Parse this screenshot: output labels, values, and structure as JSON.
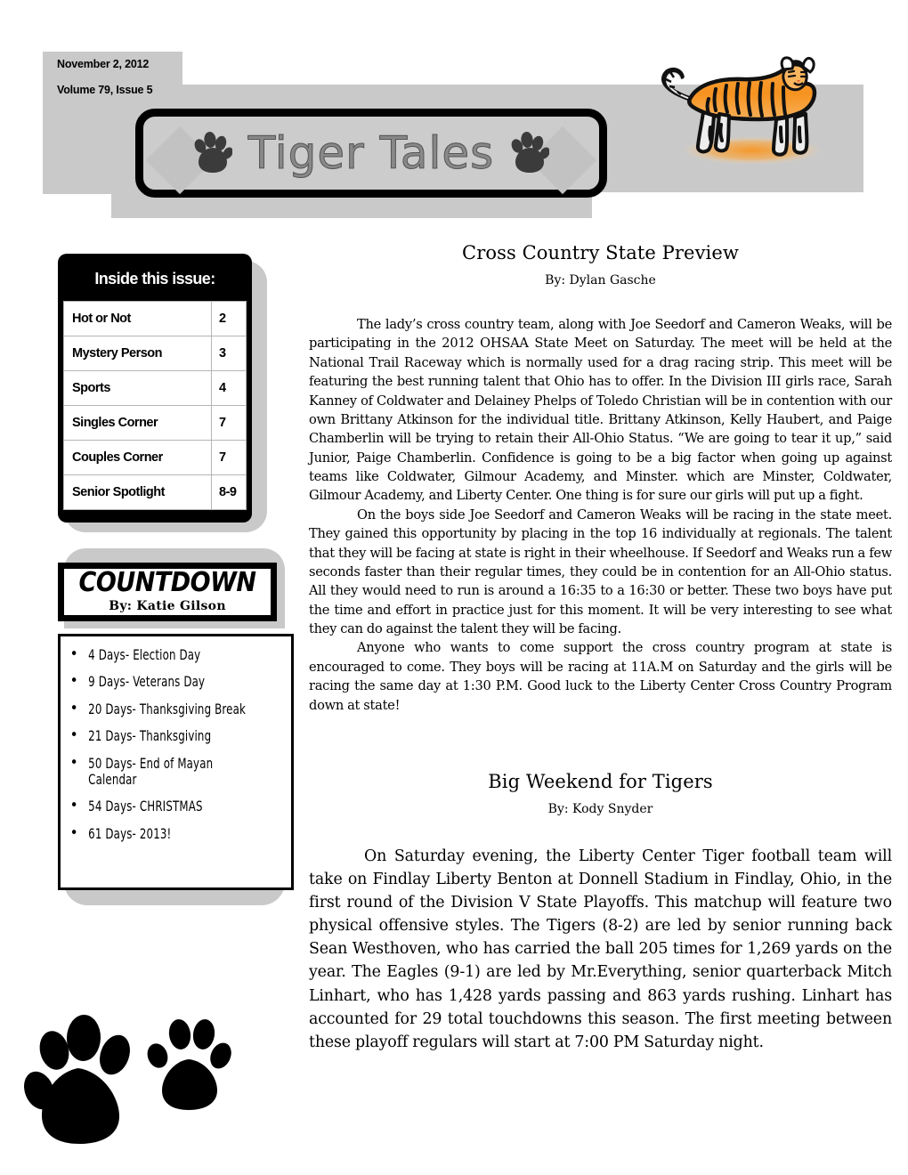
{
  "header": {
    "date": "November 2, 2012",
    "volume": "Volume 79, Issue 5",
    "masthead_title": "Tiger Tales",
    "paw_icon_name": "paw-print-icon",
    "tiger_icon_name": "tiger-mascot-icon",
    "colors": {
      "band_gray": "#c9c9c9",
      "plaque_gray": "#cccccc",
      "tiger_orange": "#f59a2e",
      "black": "#000000"
    }
  },
  "inside_issue": {
    "title": "Inside this issue:",
    "rows": [
      {
        "section": "Hot or Not",
        "page": "2"
      },
      {
        "section": "Mystery Person",
        "page": "3"
      },
      {
        "section": "Sports",
        "page": "4"
      },
      {
        "section": "Singles Corner",
        "page": "7"
      },
      {
        "section": "Couples Corner",
        "page": "7"
      },
      {
        "section": "Senior Spotlight",
        "page": "8-9"
      }
    ]
  },
  "countdown": {
    "title": "COUNTDOWN",
    "byline": "By: Katie Gilson",
    "items": [
      "4 Days- Election Day",
      "9 Days- Veterans Day",
      "20 Days- Thanksgiving Break",
      "21 Days- Thanksgiving",
      "50 Days- End of Mayan Calendar",
      "54 Days- CHRISTMAS",
      "61 Days- 2013!"
    ]
  },
  "articles": [
    {
      "headline": "Cross Country State Preview",
      "byline": "By: Dylan Gasche",
      "paragraphs": [
        "The lady’s cross country team, along with Joe Seedorf and Cameron Weaks, will be participating in the 2012 OHSAA State Meet on Saturday. The meet will be held at the National Trail Raceway which is normally used for a drag racing strip. This meet will be featuring the best running talent that  Ohio has to offer. In the Division III girls race, Sarah Kanney of Coldwater and Delainey Phelps of Toledo Christian will be in contention with our own Brittany Atkinson for the individual title.  Brittany Atkinson, Kelly Haubert, and Paige Chamberlin will be trying to retain their All-Ohio Status. “We are going to tear it up,” said Junior, Paige Chamberlin. Confidence is going to be a big factor when going up against teams like Coldwater, Gilmour Academy, and  Minster. which are Minster, Coldwater, Gilmour Academy, and Liberty Center. One thing is for sure our girls will put up a fight.",
        "On the boys side Joe Seedorf and Cameron Weaks will be racing in the state meet. They gained this opportunity by placing in the top 16 individually at regionals. The talent that they will be facing at state is right in their wheelhouse. If Seedorf and Weaks run a few seconds faster than their regular times, they could be in contention for an All-Ohio status. All they would need to run is around a 16:35 to a 16:30 or better. These two boys have put the time and effort in practice just for this moment. It will be very interesting to see what they can do against the talent they will be facing.",
        "Anyone who wants to come support the cross country program at state is encouraged to come. They boys will be racing at 11A.M on Saturday and the girls will be racing the same day at 1:30 P.M. Good luck to the Liberty Center Cross Country Program down at state!"
      ]
    },
    {
      "headline": "Big Weekend for Tigers",
      "byline": "By: Kody Snyder",
      "paragraphs": [
        "On Saturday evening, the Liberty Center Tiger football team will take on Findlay Liberty Benton at Donnell Stadium in Findlay, Ohio, in the first round of the Division V State Playoffs. This matchup will feature two physical offensive styles. The Tigers (8-2) are led by senior running back Sean Westhoven, who has carried the ball 205 times for 1,269 yards on the year. The Eagles (9-1) are led by Mr.Everything, senior quarterback Mitch Linhart, who has 1,428 yards passing and 863 yards rushing. Linhart has accounted for 29 total touchdowns this season. The first meeting between these playoff regulars will start at 7:00 PM Saturday night."
      ]
    }
  ],
  "footer": {
    "paw_icon_name": "paw-print-icon"
  }
}
